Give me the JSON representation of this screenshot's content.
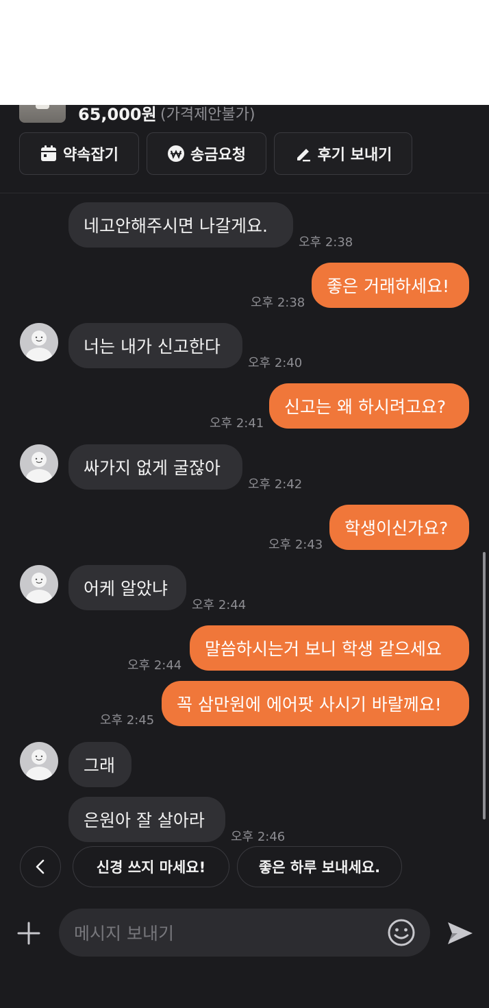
{
  "product": {
    "price": "65,000원",
    "price_note": "(가격제안불가)"
  },
  "actions": {
    "appointment": "약속잡기",
    "remit_request": "송금요청",
    "send_review": "후기 보내기"
  },
  "messages": [
    {
      "side": "in",
      "text": "네고안해주시면 나갈게요.",
      "time": "오후 2:38"
    },
    {
      "side": "out",
      "text": "좋은 거래하세요!",
      "time": "오후 2:38"
    },
    {
      "side": "in",
      "text": "너는 내가 신고한다",
      "time": "오후 2:40"
    },
    {
      "side": "out",
      "text": "신고는 왜 하시려고요?",
      "time": "오후 2:41"
    },
    {
      "side": "in",
      "text": "싸가지 없게 굴잖아",
      "time": "오후 2:42"
    },
    {
      "side": "out",
      "text": "학생이신가요?",
      "time": "오후 2:43"
    },
    {
      "side": "in",
      "text": "어케 알았냐",
      "time": "오후 2:44"
    },
    {
      "side": "out",
      "text": "말씀하시는거 보니 학생 같으세요",
      "time": "오후 2:44"
    },
    {
      "side": "out",
      "text": "꼭 삼만원에 에어팟 사시기 바랄께요!",
      "time": "오후 2:45"
    },
    {
      "side": "in",
      "text": "그래",
      "time": ""
    },
    {
      "side": "in",
      "text": "은원아 잘 살아라",
      "time": "오후 2:46"
    }
  ],
  "quick_replies": [
    "신경 쓰지 마세요!",
    "좋은 하루 보내세요."
  ],
  "composer": {
    "placeholder": "메시지 보내기"
  },
  "colors": {
    "background": "#1b1b1e",
    "incoming_bubble": "#303034",
    "outgoing_bubble": "#f0773a",
    "timestamp": "#8e8e93"
  },
  "icons": [
    "calendar-icon",
    "won-icon",
    "pencil-icon",
    "avatar-icon",
    "chevron-left-icon",
    "plus-icon",
    "emoji-icon",
    "send-icon"
  ]
}
